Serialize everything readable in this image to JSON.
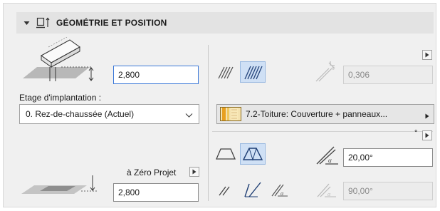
{
  "header": {
    "title": "GÉOMÉTRIE ET POSITION"
  },
  "left": {
    "height_value": "2,800",
    "story_label": "Etage d'implantation :",
    "story_select": "0. Rez-de-chaussée (Actuel)",
    "reference_label": "à Zéro Projet",
    "reference_value": "2,800"
  },
  "right": {
    "thickness_value": "0,306",
    "composite_label": "7.2-Toiture: Couverture + panneaux...",
    "degree_symbol": "°",
    "pitch_value": "20,00°",
    "edge_angle_value": "90,00°"
  },
  "colors": {
    "accent": "#3b78d8",
    "header_bg": "#e3e3e3",
    "panel_bg": "#f0f0f0",
    "selected_icon_bg": "#cfe0f5"
  }
}
